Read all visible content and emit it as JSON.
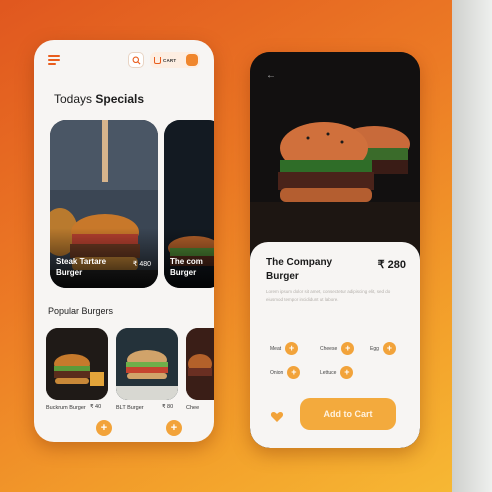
{
  "colors": {
    "accent": "#f2a33a",
    "brand": "#e95d1d",
    "detail_bg": "#121010"
  },
  "home": {
    "header": {
      "cart_label": "CART",
      "cart_count": ""
    },
    "title_plain": "Todays ",
    "title_bold": "Specials",
    "specials": [
      {
        "name": "Steak Tartare Burger",
        "price": "₹ 480"
      },
      {
        "name": "The com Burger",
        "price": ""
      }
    ],
    "popular_title": "Popular Burgers",
    "popular": [
      {
        "name": "Buckrum Burger",
        "price": "₹ 40"
      },
      {
        "name": "BLT Burger",
        "price": "₹ 80"
      },
      {
        "name": "Chee",
        "price": ""
      }
    ]
  },
  "detail": {
    "name": "The Company Burger",
    "price": "₹ 280",
    "description": "Lorem ipsum dolor sit amet, consectetur adipiscing elit, sed do eiusmod tempor incididunt ut labore.",
    "toppings": [
      "Meat",
      "Cheese",
      "Egg",
      "Onion",
      "Lettuce"
    ],
    "add_to_cart_label": "Add to Cart"
  }
}
